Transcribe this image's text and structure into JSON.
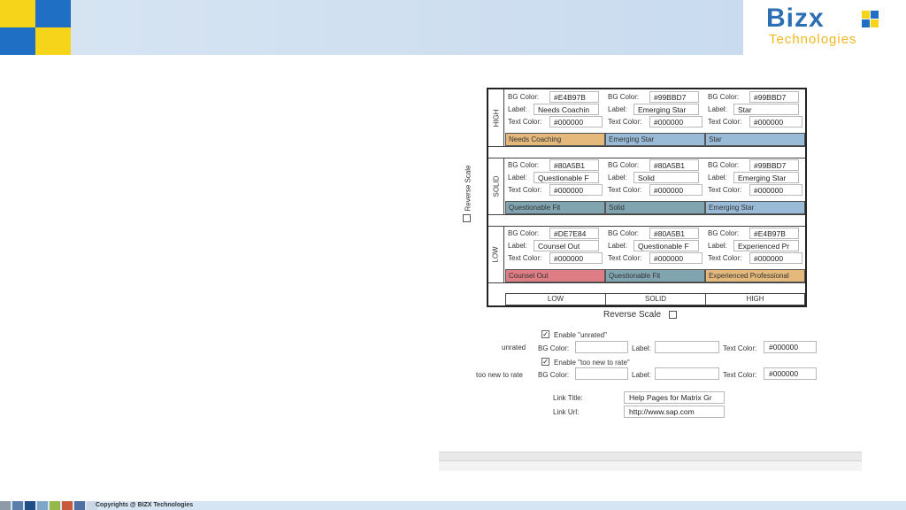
{
  "brand": {
    "name": "Bizx",
    "tagline": "Technologies",
    "colors": {
      "blue": "#1f6fc4",
      "yellow": "#f6d41a",
      "text_blue": "#2c6fb5",
      "text_yellow": "#f2b71c"
    }
  },
  "matrix": {
    "row_labels": [
      "HIGH",
      "SOLID",
      "LOW"
    ],
    "column_labels": [
      "LOW",
      "SOLID",
      "HIGH"
    ],
    "field_labels": {
      "bg": "BG Color:",
      "label": "Label:",
      "text": "Text Color:"
    },
    "reverse_scale": "Reverse Scale",
    "cells": [
      {
        "bg": "#E4B97B",
        "label": "Needs Coachin",
        "text_color": "#000000",
        "preview": "Needs Coaching",
        "color": "#E4B97B"
      },
      {
        "bg": "#99BBD7",
        "label": "Emerging Star",
        "text_color": "#000000",
        "preview": "Emerging Star",
        "color": "#99BBD7"
      },
      {
        "bg": "#99BBD7",
        "label": "Star",
        "text_color": "#000000",
        "preview": "Star",
        "color": "#99BBD7"
      },
      {
        "bg": "#80A5B1",
        "label": "Questionable F",
        "text_color": "#000000",
        "preview": "Questionable Fit",
        "color": "#80A5B1"
      },
      {
        "bg": "#80A5B1",
        "label": "Solid",
        "text_color": "#000000",
        "preview": "Solid",
        "color": "#80A5B1"
      },
      {
        "bg": "#99BBD7",
        "label": "Emerging Star",
        "text_color": "#000000",
        "preview": "Emerging Star",
        "color": "#99BBD7"
      },
      {
        "bg": "#DE7E84",
        "label": "Counsel Out",
        "text_color": "#000000",
        "preview": "Counsel Out",
        "color": "#DE7E84"
      },
      {
        "bg": "#80A5B1",
        "label": "Questionable F",
        "text_color": "#000000",
        "preview": "Questionable Fit",
        "color": "#80A5B1"
      },
      {
        "bg": "#E4B97B",
        "label": "Experienced Pr",
        "text_color": "#000000",
        "preview": "Experienced Professional",
        "color": "#E4B97B"
      }
    ]
  },
  "extra": {
    "unrated": {
      "checkbox_label": "Enable \"unrated\"",
      "checked": true,
      "row_label": "unrated",
      "bg_label": "BG Color:",
      "bg_value": "",
      "label_label": "Label:",
      "label_value": "",
      "text_label": "Text Color:",
      "text_value": "#000000"
    },
    "too_new": {
      "checkbox_label": "Enable \"too new to rate\"",
      "checked": true,
      "row_label": "too new to rate",
      "bg_label": "BG Color:",
      "bg_value": "",
      "label_label": "Label:",
      "label_value": "",
      "text_label": "Text Color:",
      "text_value": "#000000"
    },
    "link_title_label": "Link Title:",
    "link_title_value": "Help Pages for Matrix Gr",
    "link_url_label": "Link Url:",
    "link_url_value": "http://www.sap.com"
  },
  "footer": {
    "copyright": "Copyrights @ BIZX Technologies",
    "swatches": [
      "#8f9aa8",
      "#5b7fa8",
      "#1f4f86",
      "#7ea6c9",
      "#96b84a",
      "#c95b3a",
      "#4f6fa0",
      "#c9d7e6"
    ]
  }
}
